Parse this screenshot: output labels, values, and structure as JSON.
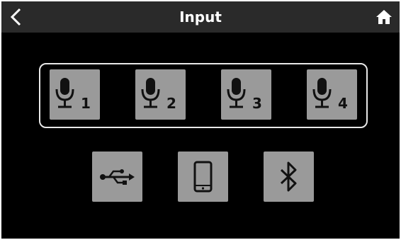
{
  "header": {
    "title": "Input",
    "back_icon": "chevron-left-icon",
    "home_icon": "home-icon"
  },
  "mic_inputs": [
    {
      "label": "1",
      "icon": "microphone-icon"
    },
    {
      "label": "2",
      "icon": "microphone-icon"
    },
    {
      "label": "3",
      "icon": "microphone-icon"
    },
    {
      "label": "4",
      "icon": "microphone-icon"
    }
  ],
  "sources": [
    {
      "name": "usb",
      "icon": "usb-icon"
    },
    {
      "name": "smartphone",
      "icon": "smartphone-icon"
    },
    {
      "name": "bluetooth",
      "icon": "bluetooth-icon"
    }
  ],
  "colors": {
    "background": "#000000",
    "header": "#2a2a2a",
    "button": "#9a9a9a",
    "selection_border": "#e8e8e8"
  }
}
